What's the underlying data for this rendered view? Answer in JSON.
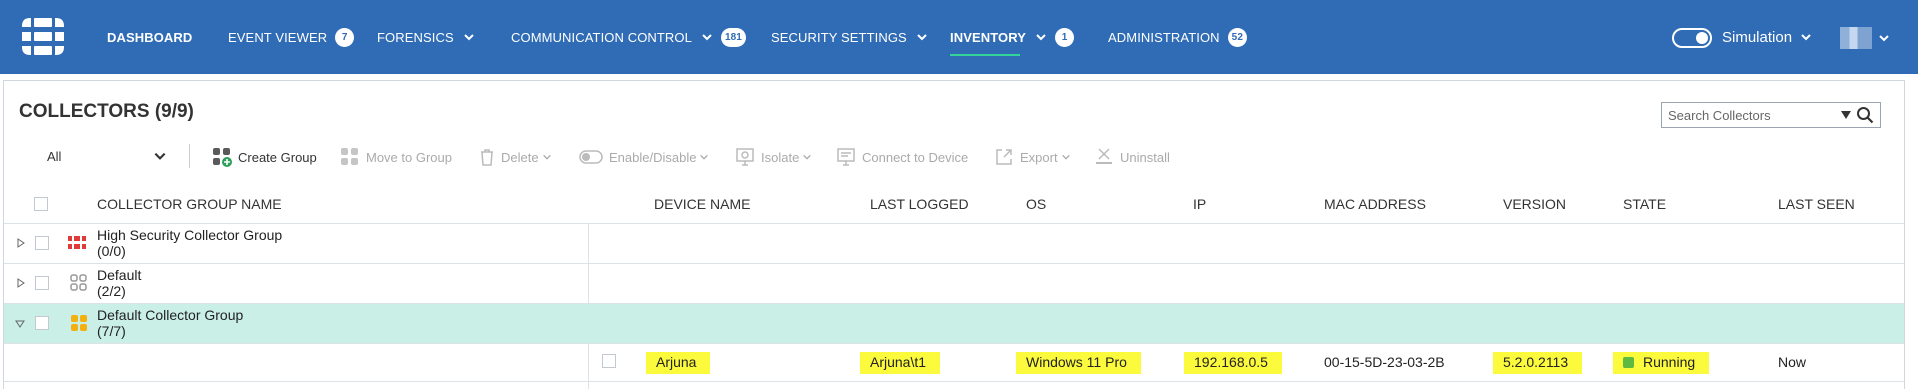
{
  "nav": {
    "items": [
      {
        "label": "DASHBOARD",
        "badge": null,
        "chevron": false,
        "active": false
      },
      {
        "label": "EVENT VIEWER",
        "badge": "7",
        "chevron": false,
        "active": false
      },
      {
        "label": "FORENSICS",
        "badge": null,
        "chevron": true,
        "active": false
      },
      {
        "label": "COMMUNICATION CONTROL",
        "badge": "181",
        "chevron": true,
        "active": false
      },
      {
        "label": "SECURITY SETTINGS",
        "badge": null,
        "chevron": true,
        "active": false
      },
      {
        "label": "INVENTORY",
        "badge": "1",
        "chevron": true,
        "active": true
      },
      {
        "label": "ADMINISTRATION",
        "badge": "52",
        "chevron": false,
        "active": false
      }
    ],
    "simulation_label": "Simulation",
    "accent": "#2f6cb5",
    "active_underline_color": "#34d399"
  },
  "panel": {
    "title": "COLLECTORS (9/9)",
    "search_placeholder": "Search Collectors"
  },
  "toolbar": {
    "filter_value": "All",
    "create_group": "Create Group",
    "move_to_group": "Move to Group",
    "delete": "Delete",
    "enable_disable": "Enable/Disable",
    "isolate": "Isolate",
    "connect_to_device": "Connect to Device",
    "export": "Export",
    "uninstall": "Uninstall"
  },
  "table": {
    "headers": {
      "group_name": "COLLECTOR GROUP NAME",
      "device_name": "DEVICE NAME",
      "last_logged": "LAST LOGGED",
      "os": "OS",
      "ip": "IP",
      "mac": "MAC ADDRESS",
      "version": "VERSION",
      "state": "STATE",
      "last_seen": "LAST SEEN"
    },
    "groups": [
      {
        "name": "High Security Collector Group",
        "count": "(0/0)",
        "expanded": false,
        "icon": "high-security-group-icon"
      },
      {
        "name": "Default",
        "count": "(2/2)",
        "expanded": false,
        "icon": "default-group-icon"
      },
      {
        "name": "Default Collector Group",
        "count": "(7/7)",
        "expanded": true,
        "icon": "collector-group-icon"
      }
    ],
    "rows": [
      {
        "device_name": "Arjuna",
        "last_logged": "Arjuna\\t1",
        "os": "Windows 11 Pro",
        "ip": "192.168.0.5",
        "mac": "00-15-5D-23-03-2B",
        "version": "5.2.0.2113",
        "state": "Running",
        "last_seen": "Now"
      }
    ],
    "highlight_color": "#fbfa3c",
    "selected_row_color": "#c9efe6",
    "running_color": "#5fbb3f"
  }
}
